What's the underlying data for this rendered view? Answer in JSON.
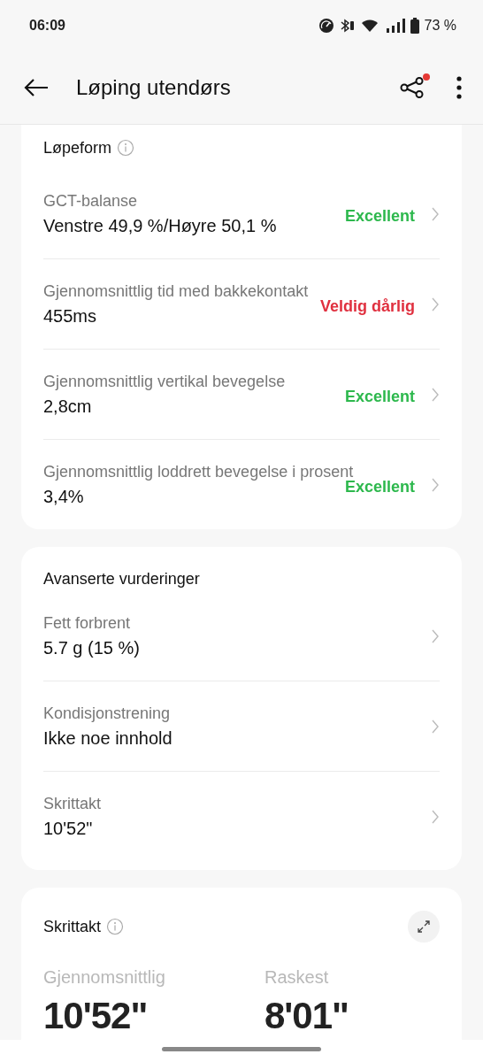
{
  "status_bar": {
    "time": "06:09",
    "battery": "73 %"
  },
  "header": {
    "title": "Løping utendørs",
    "share_badge": true
  },
  "sections": [
    {
      "title": "Løpeform",
      "info": true,
      "rows": [
        {
          "label": "GCT-balanse",
          "value": "Venstre 49,9 %/Høyre 50,1 %",
          "rating": "Excellent",
          "color": "#2db84d"
        },
        {
          "label": "Gjennomsnittlig tid med bakkekontakt",
          "value": "455ms",
          "rating": "Veldig dårlig",
          "color": "#e0303f"
        },
        {
          "label": "Gjennomsnittlig vertikal bevegelse",
          "value": "2,8cm",
          "rating": "Excellent",
          "color": "#2db84d"
        },
        {
          "label": "Gjennomsnittlig loddrett bevegelse i prosent",
          "value": "3,4%",
          "rating": "Excellent",
          "color": "#2db84d"
        }
      ]
    },
    {
      "title": "Avanserte vurderinger",
      "info": false,
      "rows": [
        {
          "label": "Fett forbrent",
          "value": "5.7 g (15 %)"
        },
        {
          "label": "Kondisjonstrening",
          "value": "Ikke noe innhold"
        },
        {
          "label": "Skrittakt",
          "value": "10'52\""
        }
      ]
    }
  ],
  "cadence": {
    "title": "Skrittakt",
    "info": true,
    "stats": [
      {
        "label": "Gjennomsnittlig",
        "value": "10'52\""
      },
      {
        "label": "Raskest",
        "value": "8'01\""
      }
    ]
  }
}
